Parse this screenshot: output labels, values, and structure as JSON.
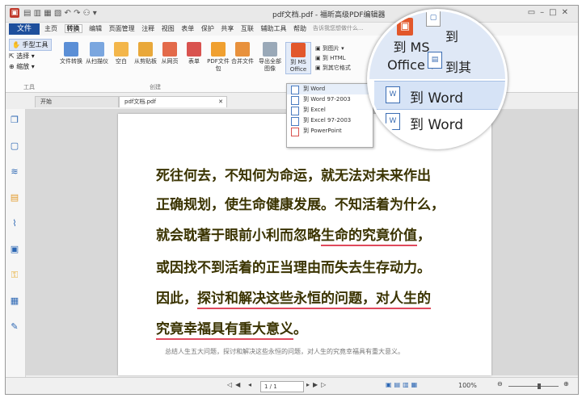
{
  "title_bar": {
    "window_title": "pdf文档.pdf - 福昕高级PDF编辑器"
  },
  "menu": {
    "file_label": "文件",
    "tabs": [
      "主页",
      "转换",
      "编辑",
      "页面管理",
      "注释",
      "视图",
      "表单",
      "保护",
      "共享",
      "互联",
      "辅助工具",
      "帮助"
    ],
    "active_tab": "转换",
    "search_placeholder": "告诉我您想做什么..."
  },
  "ribbon": {
    "tools_group_label": "工具",
    "tools": [
      "手型工具",
      "选择",
      "缩放"
    ],
    "create_group_label": "创建",
    "buttons": [
      {
        "label": "文件转换",
        "icon": "file-convert-icon"
      },
      {
        "label": "从扫描仪",
        "icon": "scanner-icon"
      },
      {
        "label": "空白",
        "icon": "blank-page-icon"
      },
      {
        "label": "从剪贴板",
        "icon": "clipboard-icon"
      },
      {
        "label": "从网页",
        "icon": "web-icon"
      },
      {
        "label": "表单",
        "icon": "form-icon"
      },
      {
        "label": "PDF文件包",
        "icon": "portfolio-icon"
      },
      {
        "label": "合并文件",
        "icon": "merge-icon"
      },
      {
        "label": "导出全部图像",
        "icon": "export-images-icon"
      },
      {
        "label": "到 MS Office",
        "icon": "office-icon"
      }
    ],
    "small_buttons": [
      "到图片",
      "到 HTML",
      "到其它格式"
    ]
  },
  "dropdown": {
    "items": [
      "到 Word",
      "到 Word 97-2003",
      "到 Excel",
      "到 Excel 97-2003",
      "到 PowerPoint"
    ]
  },
  "doc_tabs": [
    "开始",
    "pdf文档.pdf"
  ],
  "document": {
    "lines": [
      {
        "text": "死往何去，不知何为命运，就无法对未来作出"
      },
      {
        "text": "正确规划，使生命健康发展。不知活着为什么，"
      },
      {
        "text_before": "就会耽著于眼前小利而忽略",
        "underlined": "生命的究竟价值",
        "text_after": "，"
      },
      {
        "text": "或因找不到活着的正当理由而失去生存动力。"
      },
      {
        "text_before": "因此，",
        "underlined": "探讨和解决这些永恒的问题，对人生的",
        "text_after": ""
      },
      {
        "text_before": "",
        "underlined": "究竟幸福具有重大意义",
        "text_after": "。"
      }
    ],
    "caption": "总结人生五大问题，探讨和解决这些永恒的问题，对人生的究竟幸福具有重大意义。"
  },
  "status": {
    "page_indicator": "1 / 1",
    "zoom": "100%"
  },
  "magnifier": {
    "office_label_line1": "到 MS",
    "office_label_line2": "Office ▾",
    "right_label1": "到",
    "right_label2": "到其",
    "word1": "到 Word",
    "word2": "到 Word"
  }
}
